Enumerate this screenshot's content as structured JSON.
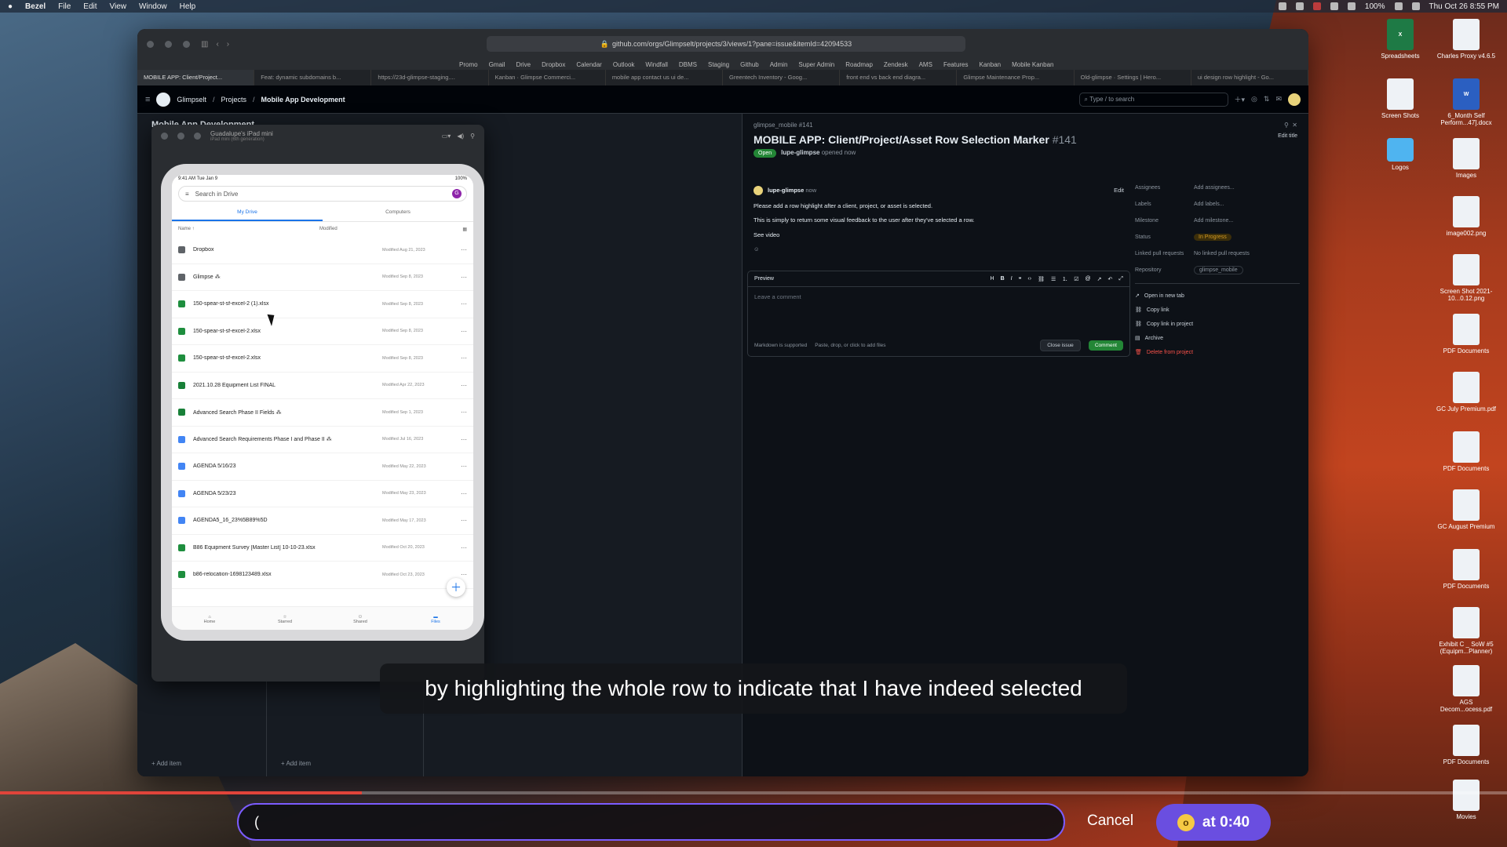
{
  "menubar": {
    "app": "Bezel",
    "items": [
      "File",
      "Edit",
      "View",
      "Window",
      "Help"
    ],
    "battery": "100%",
    "datetime": "Thu Oct 26  8:55 PM"
  },
  "browser": {
    "url": "github.com/orgs/Glimpselt/projects/3/views/1?pane=issue&itemId=42094533",
    "bookmarks": [
      "Promo",
      "Gmail",
      "Drive",
      "Dropbox",
      "Calendar",
      "Outlook",
      "Windfall",
      "DBMS",
      "Staging",
      "Github",
      "Admin",
      "Super Admin",
      "Roadmap",
      "Zendesk",
      "AMS",
      "Features",
      "Kanban",
      "Mobile Kanban"
    ],
    "tabs": [
      "MOBILE APP: Client/Project...",
      "Feat: dynamic subdomains b...",
      "https://23d-glimpse-staging....",
      "Kanban · Glimpse Commerci...",
      "mobile app contact us ui de...",
      "Greentech Inventory - Goog...",
      "front end vs back end diagra...",
      "Glimpse Maintenance Prop...",
      "Old-glimpse · Settings | Hero...",
      "ui design row highlight - Go..."
    ]
  },
  "github": {
    "breadcrumb": [
      "Glimpselt",
      "Projects",
      "Mobile App Development"
    ],
    "search_placeholder": "Type / to search"
  },
  "board": {
    "title": "Mobile App Development",
    "add_item": "+ Add item"
  },
  "ipad_window": {
    "title": "Guadalupe's iPad mini",
    "subtitle": "iPad mini (6th generation)"
  },
  "drive": {
    "status_time": "9:41 AM  Tue Jan 9",
    "battery": "100%",
    "search_placeholder": "Search in Drive",
    "avatar": "G",
    "tabs": [
      "My Drive",
      "Computers"
    ],
    "col_name": "Name ↑",
    "col_modified": "Modified",
    "files": [
      {
        "name": "Dropbox",
        "modified": "Modified Aug 21, 2023",
        "type": "folder"
      },
      {
        "name": "Glimpse ⁂",
        "modified": "Modified Sep 8, 2023",
        "type": "folder"
      },
      {
        "name": "150-spear-st-sf-excel-2 (1).xlsx",
        "modified": "Modified Sep 8, 2023",
        "type": "xlsx"
      },
      {
        "name": "150-spear-st-sf-excel-2.xlsx",
        "modified": "Modified Sep 8, 2023",
        "type": "xlsx"
      },
      {
        "name": "150-spear-st-sf-excel-2.xlsx",
        "modified": "Modified Sep 8, 2023",
        "type": "xlsx"
      },
      {
        "name": "2021.10.28 Equipment List FINAL",
        "modified": "Modified Apr 22, 2023",
        "type": "sheet"
      },
      {
        "name": "Advanced Search Phase II Fields ⁂",
        "modified": "Modified Sep 1, 2023",
        "type": "sheet"
      },
      {
        "name": "Advanced Search Requirements Phase I and Phase II ⁂",
        "modified": "Modified Jul 16, 2023",
        "type": "doc"
      },
      {
        "name": "AGENDA 5/16/23",
        "modified": "Modified May 22, 2023",
        "type": "doc"
      },
      {
        "name": "AGENDA 5/23/23",
        "modified": "Modified May 23, 2023",
        "type": "doc"
      },
      {
        "name": "AGENDA5_16_23%5B89%5D",
        "modified": "Modified May 17, 2023",
        "type": "doc"
      },
      {
        "name": "B86 Equipment Survey [Master List] 10-10-23.xlsx",
        "modified": "Modified Oct 20, 2023",
        "type": "xlsx"
      },
      {
        "name": "b86-relocation-1698123489.xlsx",
        "modified": "Modified Oct 23, 2023",
        "type": "xlsx"
      }
    ],
    "nav": [
      "Home",
      "Starred",
      "Shared",
      "Files"
    ]
  },
  "issue": {
    "repo": "glimpse_mobile #141",
    "title": "MOBILE APP: Client/Project/Asset Row Selection Marker",
    "number": "#141",
    "state": "Open",
    "author": "lupe-glimpse",
    "opened": "opened now",
    "edit_title": "Edit title",
    "comment_author": "lupe-glimpse",
    "comment_time": "now",
    "edit": "Edit",
    "body": [
      "Please add a row highlight after a client, project, or asset is selected.",
      "This is simply to return some visual feedback to the user after they've selected a row.",
      "See video"
    ],
    "preview": "Preview",
    "comment_placeholder": "Leave a comment",
    "markdown": "Markdown is supported",
    "attach": "Paste, drop, or click to add files",
    "close_issue": "Close issue",
    "comment_btn": "Comment",
    "sidebar": [
      {
        "label": "Assignees",
        "value": "Add assignees..."
      },
      {
        "label": "Labels",
        "value": "Add labels..."
      },
      {
        "label": "Milestone",
        "value": "Add milestone..."
      },
      {
        "label": "Status",
        "value": "In Progress"
      },
      {
        "label": "Linked pull requests",
        "value": "No linked pull requests"
      },
      {
        "label": "Repository",
        "value": "glimpse_mobile"
      }
    ],
    "actions": [
      "Open in new tab",
      "Copy link",
      "Copy link in project",
      "Archive",
      "Delete from project"
    ]
  },
  "caption": "by highlighting the whole row to indicate that I have indeed selected",
  "recorder": {
    "input_value": "(",
    "cancel": "Cancel",
    "at": "at 0:40",
    "progress": 0.24
  },
  "desktop": [
    "Spreadsheets",
    "Charles Proxy v4.6.5",
    "Screen Shots",
    "6_Month Self Perform...47].docx",
    "Logos",
    "Images",
    "image002.png",
    "Screen Shot 2021-10...0.12.png",
    "PDF Documents",
    "GC July Premium.pdf",
    "PDF Documents",
    "GC August Premium",
    "PDF Documents",
    "Exhibit C _ SoW #5 (Equipm...Planner)",
    "AGS Decom...ocess.pdf",
    "PDF Documents",
    "Movies"
  ],
  "colors": {
    "accent": "#7b5cff",
    "github_green": "#238636",
    "status_yellow": "#d29922",
    "danger": "#f85149"
  }
}
